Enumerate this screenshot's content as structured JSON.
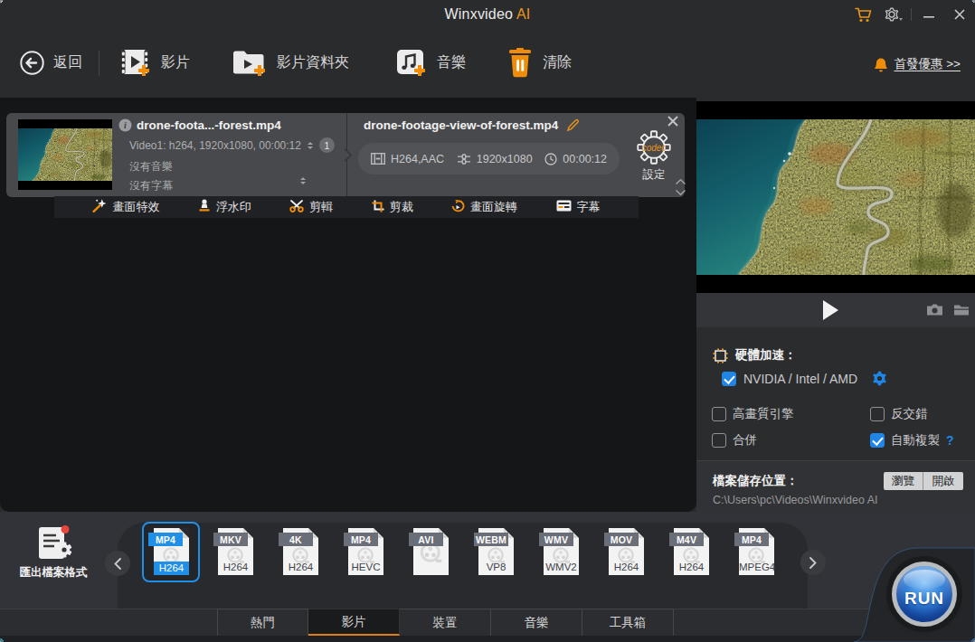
{
  "colors": {
    "accent_orange": "#e8941c",
    "accent_blue": "#1f8fe8",
    "header_bg": "#2a2b2d",
    "list_bg": "#151617",
    "card_bg": "#48494c"
  },
  "titlebar": {
    "brand": "Winxvideo",
    "brand_accent": "AI"
  },
  "toolbar": {
    "back": "返回",
    "add_video": "影片",
    "add_video_folder": "影片資料夾",
    "add_music": "音樂",
    "clear": "清除",
    "promo": "首發優惠 >>"
  },
  "source_file": {
    "name": "drone-foota...-forest.mp4",
    "video_info": "Video1: h264, 1920x1080, 00:00:12",
    "audio_info": "沒有音樂",
    "subtitle_info": "沒有字幕",
    "track_count": "1"
  },
  "output_file": {
    "name": "drone-footage-view-of-forest.mp4",
    "codec": "H264,AAC",
    "resolution": "1920x1080",
    "duration": "00:00:12",
    "gear_text": "codec",
    "settings_label": "設定"
  },
  "edit_tools": [
    {
      "label": "畫面特效",
      "icon": "magic-wand"
    },
    {
      "label": "浮水印",
      "icon": "watermark-stamp"
    },
    {
      "label": "剪輯",
      "icon": "scissors"
    },
    {
      "label": "剪裁",
      "icon": "crop"
    },
    {
      "label": "畫面旋轉",
      "icon": "rotate"
    },
    {
      "label": "字幕",
      "icon": "subtitle"
    }
  ],
  "acceleration": {
    "hw_label": "硬體加速：",
    "gpu_option": "NVIDIA / Intel / AMD",
    "gpu_checked": true,
    "options": [
      {
        "label": "高畫質引擎",
        "checked": false
      },
      {
        "label": "反交錯",
        "checked": false
      },
      {
        "label": "合併",
        "checked": false
      },
      {
        "label": "自動複製",
        "checked": true,
        "help": "?"
      }
    ]
  },
  "save_location": {
    "label": "檔案儲存位置：",
    "browse": "瀏覽",
    "open": "開啟",
    "path": "C:\\Users\\pc\\Videos\\Winxvideo AI"
  },
  "formats": {
    "export_label": "匯出檔案格式",
    "tiles": [
      {
        "container": "MP4",
        "codec": "H264",
        "selected": true
      },
      {
        "container": "MKV",
        "codec": "H264",
        "selected": false
      },
      {
        "container": "4K",
        "codec": "H264",
        "selected": false
      },
      {
        "container": "MP4",
        "codec": "HEVC",
        "selected": false
      },
      {
        "container": "AVI",
        "codec": "",
        "selected": false
      },
      {
        "container": "WEBM",
        "codec": "VP8",
        "selected": false
      },
      {
        "container": "WMV",
        "codec": "WMV2",
        "selected": false
      },
      {
        "container": "MOV",
        "codec": "H264",
        "selected": false
      },
      {
        "container": "M4V",
        "codec": "H264",
        "selected": false
      },
      {
        "container": "MP4",
        "codec": "MPEG4",
        "selected": false
      }
    ]
  },
  "category_tabs": [
    {
      "label": "熱門",
      "active": false
    },
    {
      "label": "影片",
      "active": true
    },
    {
      "label": "裝置",
      "active": false
    },
    {
      "label": "音樂",
      "active": false
    },
    {
      "label": "工具箱",
      "active": false
    }
  ],
  "run_label": "RUN"
}
